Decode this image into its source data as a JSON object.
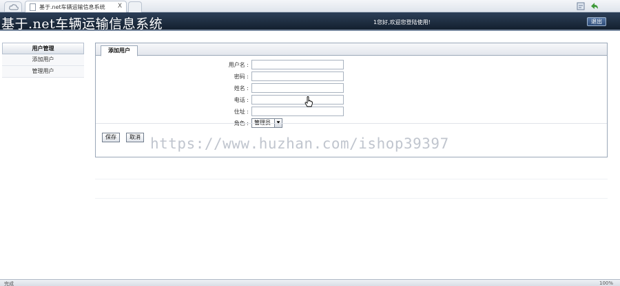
{
  "browser": {
    "tab_title": "基于.net车辆运输信息系统",
    "tab_close": "X"
  },
  "header": {
    "title": "基于.net车辆运输信息系统",
    "welcome": "1您好,欢迎您登陆使用!",
    "logout_label": "退出"
  },
  "sidebar": {
    "heading": "用户管理",
    "items": [
      {
        "label": "添加用户"
      },
      {
        "label": "管理用户"
      }
    ]
  },
  "panel": {
    "tab_label": "添加用户",
    "fields": [
      {
        "label": "用户名 :",
        "value": ""
      },
      {
        "label": "密码 :",
        "value": ""
      },
      {
        "label": "姓名 :",
        "value": ""
      },
      {
        "label": "电话 :",
        "value": ""
      },
      {
        "label": "住址 :",
        "value": ""
      }
    ],
    "role": {
      "label": "角色 :",
      "selected": "管理员"
    },
    "save_label": "保存",
    "cancel_label": "取消"
  },
  "watermark": "https://www.huzhan.com/ishop39397",
  "status": {
    "left": "完成",
    "right": "100%"
  }
}
